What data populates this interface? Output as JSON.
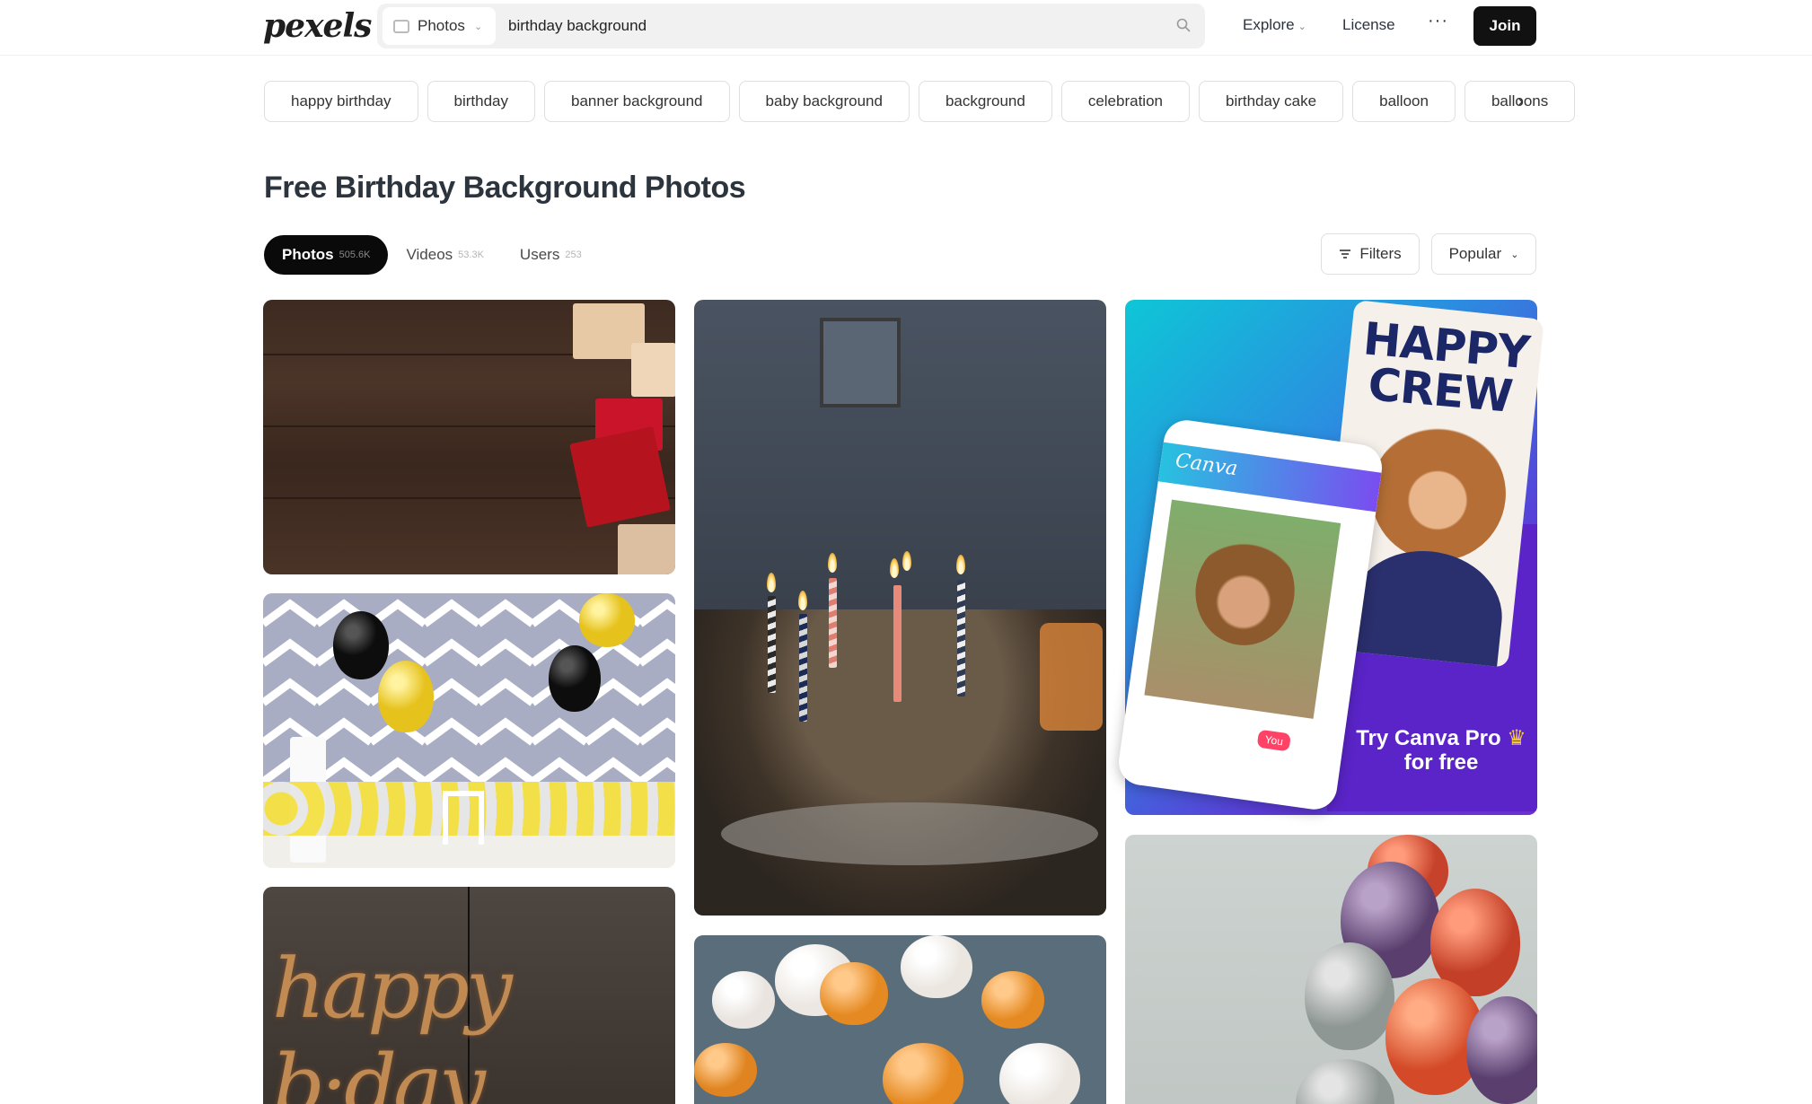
{
  "brand": {
    "logo_text": "pexels"
  },
  "search": {
    "type_label": "Photos",
    "query": "birthday background"
  },
  "nav": {
    "explore": "Explore",
    "license": "License",
    "more": "···",
    "join": "Join"
  },
  "tags": [
    "happy birthday",
    "birthday",
    "banner background",
    "baby background",
    "background",
    "celebration",
    "birthday cake",
    "balloon",
    "balloons"
  ],
  "page_title": "Free Birthday Background Photos",
  "tabs": [
    {
      "label": "Photos",
      "count": "505.6K",
      "active": true
    },
    {
      "label": "Videos",
      "count": "53.3K",
      "active": false
    },
    {
      "label": "Users",
      "count": "253",
      "active": false
    }
  ],
  "filters": {
    "filters_label": "Filters",
    "sort_label": "Popular"
  },
  "ad": {
    "headline": "HAPPY CREW",
    "app_name": "Canva",
    "badge": "You",
    "cta_line1": "Try Canva Pro",
    "cta_line2": "for free"
  },
  "photos": [
    {
      "subject": "gift boxes on wooden background"
    },
    {
      "subject": "balloons on chevron backdrop"
    },
    {
      "subject": "happy bday foil balloons"
    },
    {
      "subject": "birthday cake with candles"
    },
    {
      "subject": "balloons on ceiling"
    },
    {
      "subject": "metallic balloons bunch"
    }
  ],
  "colors": {
    "accent": "#0a0a0a",
    "ad_purple": "#6d2fd0",
    "ad_cyan": "#0ec6d6"
  }
}
